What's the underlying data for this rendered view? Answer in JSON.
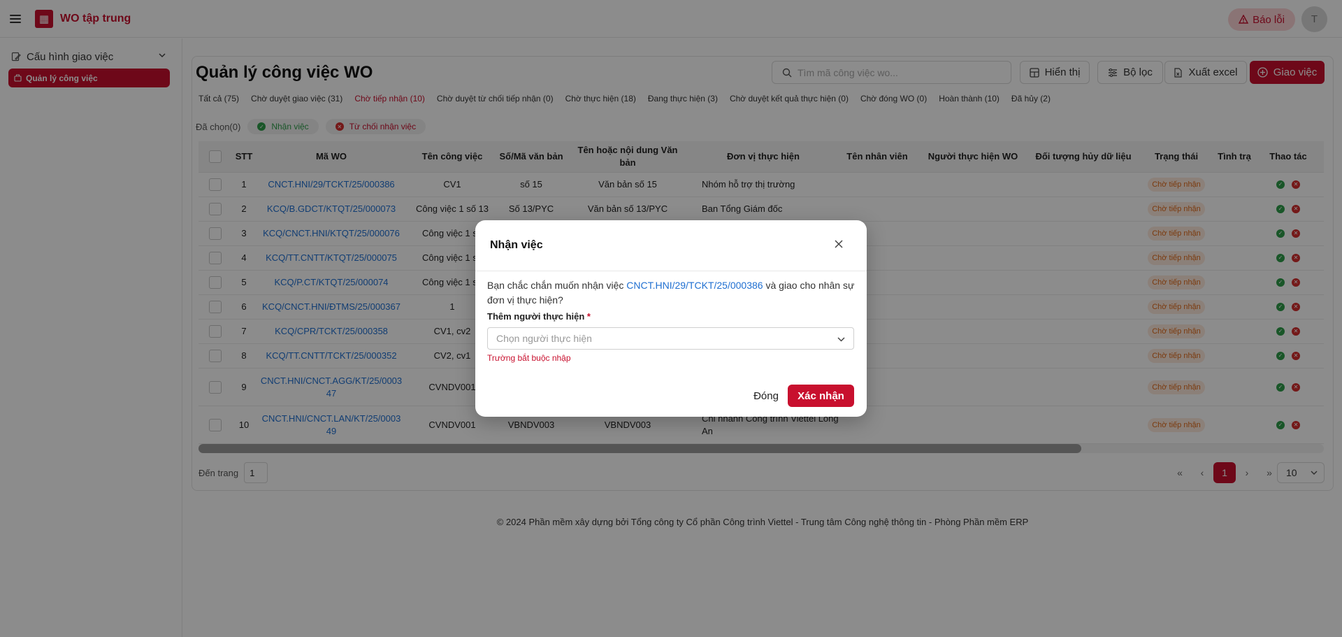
{
  "app": {
    "title": "WO tập trung",
    "logo_icon": "app-logo-icon",
    "report_label": "Báo lỗi",
    "avatar_letter": "T",
    "brand_color": "#c8102e"
  },
  "sidebar": {
    "group_label": "Cấu hình giao việc",
    "active_item": "Quản lý công việc"
  },
  "page": {
    "title": "Quản lý công việc WO",
    "search_placeholder": "Tìm mã công việc wo...",
    "buttons": {
      "display": "Hiển thị",
      "filter": "Bộ lọc",
      "export": "Xuất excel",
      "assign": "Giao việc"
    }
  },
  "tabs": [
    "Tất cả (75)",
    "Chờ duyệt giao việc (31)",
    "Chờ tiếp nhận (10)",
    "Chờ duyệt từ chối tiếp nhận (0)",
    "Chờ thực hiện (18)",
    "Đang thực hiện (3)",
    "Chờ duyệt kết quả thực hiện (0)",
    "Chờ đóng WO (0)",
    "Hoàn thành (10)",
    "Đã hủy (2)"
  ],
  "active_tab_index": 2,
  "selection": {
    "selected_label": "Đã chọn(0)",
    "accept_label": "Nhận việc",
    "reject_label": "Từ chối nhận việc"
  },
  "table": {
    "headers": [
      "STT",
      "Mã WO",
      "Tên công việc",
      "Số/Mã văn bản",
      "Tên hoặc nội dung Văn bản",
      "Đơn vị thực hiện",
      "Tên nhân viên",
      "Người thực hiện WO",
      "Đối tượng hủy dữ liệu",
      "Trạng thái",
      "Tình trạ",
      "Thao tác"
    ],
    "rows": [
      {
        "stt": "1",
        "ma_wo": "CNCT.HNI/29/TCKT/25/000386",
        "ten_cv": "CV1",
        "so_vb": "số 15",
        "ten_vb": "Văn bản số 15",
        "don_vi": "Nhóm hỗ trợ thị trường",
        "status": "Chờ tiếp nhận"
      },
      {
        "stt": "2",
        "ma_wo": "KCQ/B.GDCT/KTQT/25/000073",
        "ten_cv": "Công việc 1 số 13",
        "so_vb": "Số 13/PYC",
        "ten_vb": "Văn bản số 13/PYC",
        "don_vi": "Ban Tổng Giám đốc",
        "status": "Chờ tiếp nhận"
      },
      {
        "stt": "3",
        "ma_wo": "KCQ/CNCT.HNI/KTQT/25/000076",
        "ten_cv": "Công việc 1 số",
        "so_vb": "",
        "ten_vb": "",
        "don_vi": "",
        "status": "Chờ tiếp nhận"
      },
      {
        "stt": "4",
        "ma_wo": "KCQ/TT.CNTT/KTQT/25/000075",
        "ten_cv": "Công việc 1 số",
        "so_vb": "",
        "ten_vb": "",
        "don_vi": "",
        "status": "Chờ tiếp nhận"
      },
      {
        "stt": "5",
        "ma_wo": "KCQ/P.CT/KTQT/25/000074",
        "ten_cv": "Công việc 1 số",
        "so_vb": "",
        "ten_vb": "",
        "don_vi": "",
        "status": "Chờ tiếp nhận"
      },
      {
        "stt": "6",
        "ma_wo": "KCQ/CNCT.HNI/ĐTMS/25/000367",
        "ten_cv": "1",
        "so_vb": "",
        "ten_vb": "",
        "don_vi": "",
        "status": "Chờ tiếp nhận"
      },
      {
        "stt": "7",
        "ma_wo": "KCQ/CPR/TCKT/25/000358",
        "ten_cv": "CV1, cv2",
        "so_vb": "",
        "ten_vb": "",
        "don_vi": "",
        "status": "Chờ tiếp nhận"
      },
      {
        "stt": "8",
        "ma_wo": "KCQ/TT.CNTT/TCKT/25/000352",
        "ten_cv": "CV2, cv1",
        "so_vb": "",
        "ten_vb": "",
        "don_vi": "",
        "status": "Chờ tiếp nhận"
      },
      {
        "stt": "9",
        "ma_wo": "CNCT.HNI/CNCT.AGG/KT/25/000347",
        "ma_wo_l1": "CNCT.HNI/CNCT.AGG/KT/25/0003",
        "ma_wo_l2": "47",
        "ten_cv": "CVNDV001",
        "so_vb": "",
        "ten_vb": "",
        "don_vi": "",
        "status": "Chờ tiếp nhận"
      },
      {
        "stt": "10",
        "ma_wo": "CNCT.HNI/CNCT.LAN/KT/25/000349",
        "ma_wo_l1": "CNCT.HNI/CNCT.LAN/KT/25/0003",
        "ma_wo_l2": "49",
        "ten_cv": "CVNDV001",
        "so_vb": "VBNDV003",
        "ten_vb": "VBNDV003",
        "don_vi": "Chi nhánh Công trình Viettel Long An",
        "status": "Chờ tiếp nhận"
      }
    ]
  },
  "pagination": {
    "goto_label": "Đến trang",
    "goto_value": "1",
    "current_page": "1",
    "page_size": "10"
  },
  "footer": "© 2024 Phần mềm xây dựng bởi Tổng công ty Cổ phần Công trình Viettel - Trung tâm Công nghệ thông tin - Phòng Phần mềm ERP",
  "modal": {
    "title": "Nhận việc",
    "msg_before": "Bạn chắc chắn muốn nhận việc ",
    "msg_code": "CNCT.HNI/29/TCKT/25/000386",
    "msg_after": " và giao cho nhân sự đơn vị thực hiện?",
    "field_label": "Thêm người thực hiện",
    "field_required_mark": "*",
    "select_placeholder": "Chọn người thực hiện",
    "error_text": "Trường bắt buộc nhập",
    "close_label": "Đóng",
    "confirm_label": "Xác nhận"
  }
}
